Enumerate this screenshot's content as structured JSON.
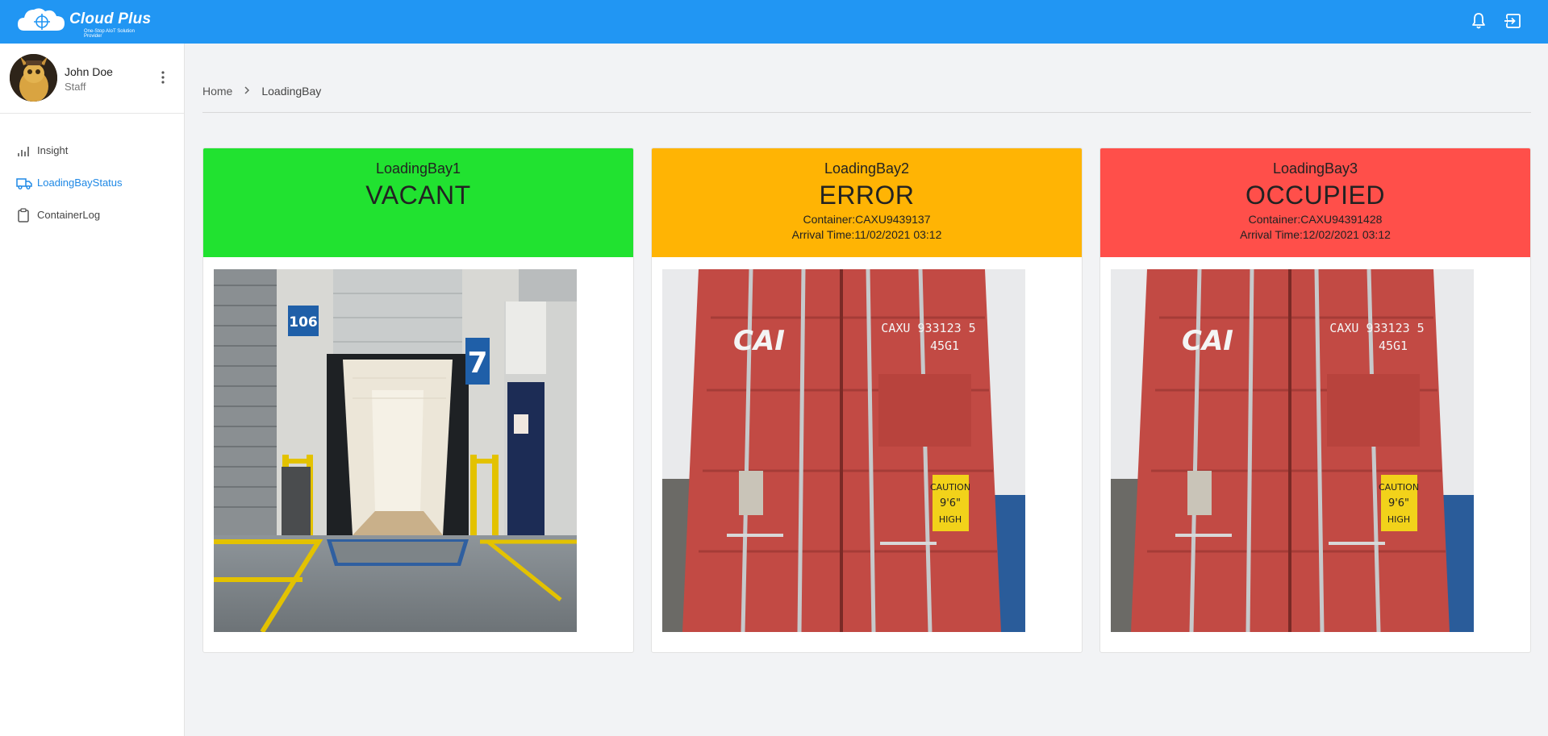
{
  "app": {
    "brand": "Cloud Plus",
    "tagline": "One-Stop AIoT Solution Provider",
    "colors": {
      "header": "#2196f3",
      "vacant": "#21e230",
      "error": "#ffb404",
      "occupied": "#ff4f4a",
      "active_nav": "#1e88e5"
    }
  },
  "header": {
    "icons": [
      "bell-icon",
      "logout-icon"
    ]
  },
  "user": {
    "name": "John Doe",
    "role": "Staff"
  },
  "sidebar": {
    "items": [
      {
        "label": "Insight",
        "icon": "bar-chart-icon",
        "active": false
      },
      {
        "label": "LoadingBayStatus",
        "icon": "truck-icon",
        "active": true
      },
      {
        "label": "ContainerLog",
        "icon": "clipboard-icon",
        "active": false
      }
    ]
  },
  "breadcrumb": {
    "home": "Home",
    "current": "LoadingBay"
  },
  "bays": [
    {
      "name": "LoadingBay1",
      "status": "VACANT",
      "container": "",
      "arrival": "",
      "image": "open loading dock door with empty trailer"
    },
    {
      "name": "LoadingBay2",
      "status": "ERROR",
      "container": "Container:CAXU9439137",
      "arrival": "Arrival Time:11/02/2021 03:12",
      "image": "red shipping container doors"
    },
    {
      "name": "LoadingBay3",
      "status": "OCCUPIED",
      "container": "Container:CAXU94391428",
      "arrival": "Arrival Time:12/02/2021 03:12",
      "image": "red shipping container doors"
    }
  ],
  "container_markings": {
    "brand": "CAI",
    "number": "CAXU 933123 5",
    "type": "45G1",
    "caution": [
      "CAUTION",
      "9'6\"",
      "HIGH"
    ]
  },
  "dock_numbers": [
    "106",
    "7"
  ]
}
